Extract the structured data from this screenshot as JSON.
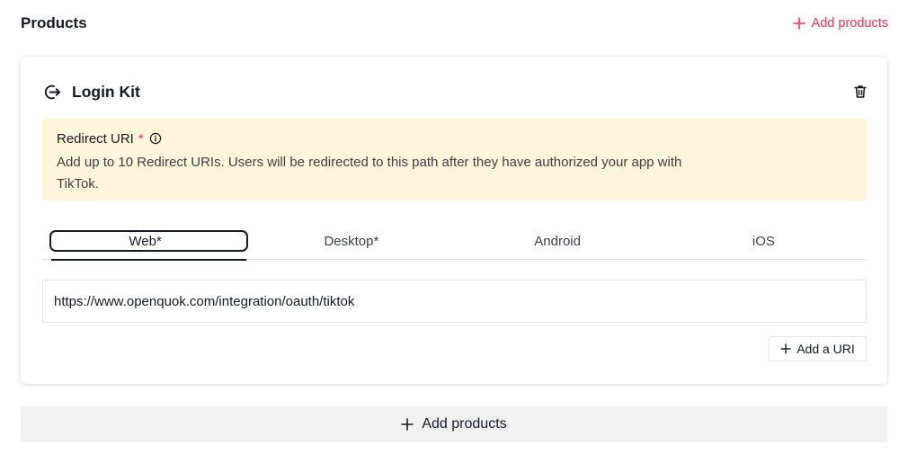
{
  "header": {
    "title": "Products",
    "add_label": "Add products"
  },
  "card": {
    "title": "Login Kit",
    "title_icon": "login-arrow-icon",
    "delete_icon": "trash-icon"
  },
  "notice": {
    "title": "Redirect URI",
    "required_marker": "*",
    "description": "Add up to 10 Redirect URIs. Users will be redirected to this path after they have authorized your app with TikTok."
  },
  "tabs": [
    {
      "label": "Web*",
      "active": true
    },
    {
      "label": "Desktop*",
      "active": false
    },
    {
      "label": "Android",
      "active": false
    },
    {
      "label": "iOS",
      "active": false
    }
  ],
  "uri_input": {
    "value": "https://www.openquok.com/integration/oauth/tiktok"
  },
  "add_uri_label": "Add a URI",
  "bottom_add_label": "Add products",
  "colors": {
    "accent": "#fe2c55",
    "notice_bg": "#fef6db",
    "text": "#161823",
    "button_bg": "#f1f1f2"
  }
}
